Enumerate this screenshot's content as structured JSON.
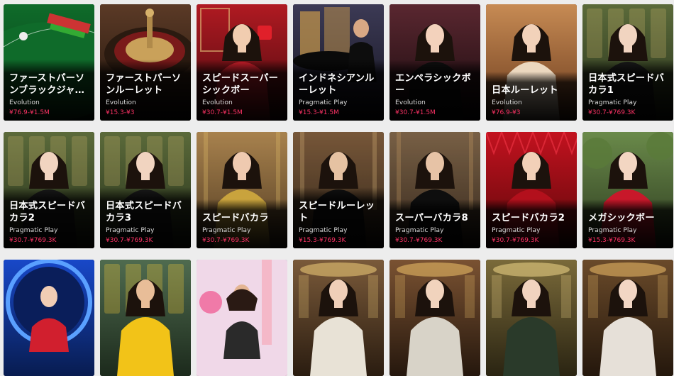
{
  "games": [
    {
      "title": "ファーストパーソンブラックジャ…",
      "provider": "Evolution",
      "range": "¥76.9-¥1.5M",
      "art": "blackjack"
    },
    {
      "title": "ファーストパーソンルーレット",
      "provider": "Evolution",
      "range": "¥15.3-¥3",
      "art": "roulette"
    },
    {
      "title": "スピードスーパーシックボー",
      "provider": "Evolution",
      "range": "¥30.7-¥1.5M",
      "art": "red-dealer"
    },
    {
      "title": "インドネシアンルーレット",
      "provider": "Pragmatic Play",
      "range": "¥15.3-¥1.5M",
      "art": "temple"
    },
    {
      "title": "エンペラシックボー",
      "provider": "Evolution",
      "range": "¥30.7-¥1.5M",
      "art": "blonde-dealer"
    },
    {
      "title": "日本ルーレット",
      "provider": "Evolution",
      "range": "¥76.9-¥3",
      "art": "dark-hair-dealer"
    },
    {
      "title": "日本式スピードバカラ1",
      "provider": "Pragmatic Play",
      "range": "¥30.7-¥769.3K",
      "art": "kimono-green"
    },
    {
      "title": "日本式スピードバカラ2",
      "provider": "Pragmatic Play",
      "range": "¥30.7-¥769.3K",
      "art": "kimono-green"
    },
    {
      "title": "日本式スピードバカラ3",
      "provider": "Pragmatic Play",
      "range": "¥30.7-¥769.3K",
      "art": "kimono-green"
    },
    {
      "title": "スピードバカラ",
      "provider": "Pragmatic Play",
      "range": "¥30.7-¥769.3K",
      "art": "gold-dress"
    },
    {
      "title": "スピードルーレット",
      "provider": "Pragmatic Play",
      "range": "¥15.3-¥769.3K",
      "art": "male-dealer"
    },
    {
      "title": "スーパーバカラ8",
      "provider": "Pragmatic Play",
      "range": "¥30.7-¥769.3K",
      "art": "black-dress"
    },
    {
      "title": "スピードバカラ2",
      "provider": "Pragmatic Play",
      "range": "¥30.7-¥769.3K",
      "art": "red-wall"
    },
    {
      "title": "メガシックボー",
      "provider": "Pragmatic Play",
      "range": "¥15.3-¥769.3K",
      "art": "garden-red"
    },
    {
      "title": "",
      "provider": "",
      "range": "",
      "art": "blue-ring"
    },
    {
      "title": "",
      "provider": "",
      "range": "",
      "art": "yellow-dress"
    },
    {
      "title": "",
      "provider": "",
      "range": "",
      "art": "candy"
    },
    {
      "title": "",
      "provider": "",
      "range": "",
      "art": "casino-1"
    },
    {
      "title": "",
      "provider": "",
      "range": "",
      "art": "casino-2"
    },
    {
      "title": "",
      "provider": "",
      "range": "",
      "art": "casino-3"
    },
    {
      "title": "",
      "provider": "",
      "range": "",
      "art": "casino-4"
    }
  ],
  "palettes": {
    "blackjack": {
      "bg1": "#0f6b2a",
      "bg2": "#0a3d18",
      "accent": "#e8e8e8",
      "skin": "#f0d6c0",
      "cloth": "#1a1a1a"
    },
    "roulette": {
      "bg1": "#5b3a26",
      "bg2": "#1e120b",
      "accent": "#c9a15a",
      "skin": "#d9b38a",
      "cloth": "#3b2415"
    },
    "red-dealer": {
      "bg1": "#b01a22",
      "bg2": "#4a0a0e",
      "accent": "#e3c17a",
      "skin": "#f1cdb0",
      "cloth": "#d0202c"
    },
    "temple": {
      "bg1": "#3c3a55",
      "bg2": "#141320",
      "accent": "#c99a4b",
      "skin": "#d9a884",
      "cloth": "#0d0d0d"
    },
    "blonde-dealer": {
      "bg1": "#5a2730",
      "bg2": "#170a0d",
      "accent": "#f2dfb0",
      "skin": "#f3d2bc",
      "cloth": "#101010"
    },
    "dark-hair-dealer": {
      "bg1": "#c78b54",
      "bg2": "#6a3a1c",
      "accent": "#f3e6d0",
      "skin": "#f2d2ba",
      "cloth": "#ecd8bf"
    },
    "kimono-green": {
      "bg1": "#5b6a3a",
      "bg2": "#25301a",
      "accent": "#c8b26a",
      "skin": "#f1d4c0",
      "cloth": "#1a1a1a"
    },
    "gold-dress": {
      "bg1": "#a07a4a",
      "bg2": "#3d2a18",
      "accent": "#e6c16a",
      "skin": "#efcab0",
      "cloth": "#c9a33d"
    },
    "male-dealer": {
      "bg1": "#6a4a30",
      "bg2": "#1f140c",
      "accent": "#d9b77a",
      "skin": "#e6c2a2",
      "cloth": "#111111"
    },
    "black-dress": {
      "bg1": "#6e5842",
      "bg2": "#221812",
      "accent": "#c79d63",
      "skin": "#e7c3a6",
      "cloth": "#0e0e0e"
    },
    "red-wall": {
      "bg1": "#c3121f",
      "bg2": "#5a0709",
      "accent": "#f0c5a0",
      "skin": "#f2d0b8",
      "cloth": "#b3101c"
    },
    "garden-red": {
      "bg1": "#6a8a4a",
      "bg2": "#2c3a1f",
      "accent": "#e9cf9a",
      "skin": "#f3d6c2",
      "cloth": "#c8182a"
    },
    "blue-ring": {
      "bg1": "#1848c8",
      "bg2": "#081c50",
      "accent": "#ff4a4a",
      "skin": "#f1cdb4",
      "cloth": "#d11f2e"
    },
    "yellow-dress": {
      "bg1": "#4f6b4f",
      "bg2": "#1c2a1c",
      "accent": "#ffd23a",
      "skin": "#e8bd98",
      "cloth": "#f2c318"
    },
    "candy": {
      "bg1": "#b8d8e8",
      "bg2": "#e06a9a",
      "accent": "#f4e27a",
      "skin": "#e4b593",
      "cloth": "#2a2a2a"
    },
    "casino-1": {
      "bg1": "#7a5a3a",
      "bg2": "#2a1c10",
      "accent": "#f2cf7a",
      "skin": "#f0cfb8",
      "cloth": "#e8e2d6"
    },
    "casino-2": {
      "bg1": "#7a5232",
      "bg2": "#25170d",
      "accent": "#f0c26a",
      "skin": "#f1d3bd",
      "cloth": "#d8d3c8"
    },
    "casino-3": {
      "bg1": "#7a6a3a",
      "bg2": "#2a2412",
      "accent": "#f2d88a",
      "skin": "#f1d3bf",
      "cloth": "#2a3a2a"
    },
    "casino-4": {
      "bg1": "#6a4a2a",
      "bg2": "#24170c",
      "accent": "#f0c06a",
      "skin": "#f2d6c4",
      "cloth": "#e6e0d8"
    }
  }
}
